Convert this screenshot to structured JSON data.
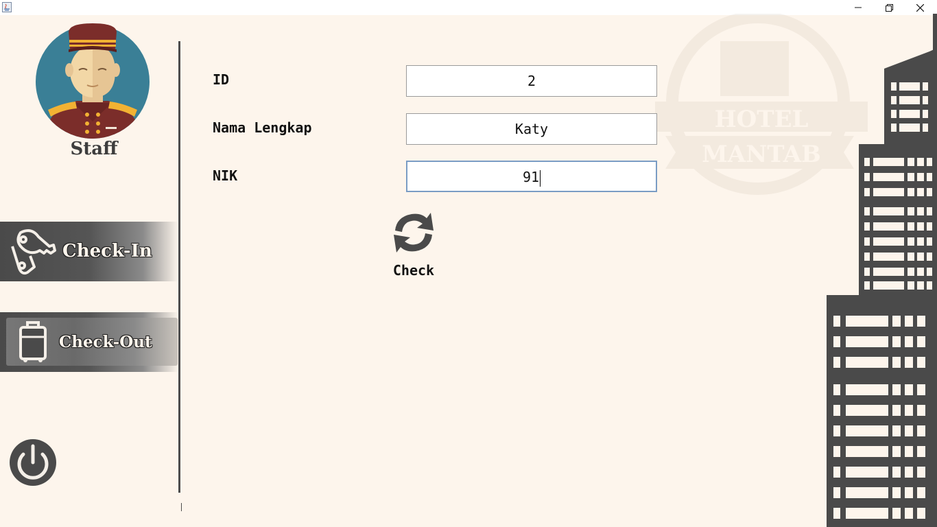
{
  "window": {
    "title": "",
    "controls": {
      "minimize": "minimize-icon",
      "restore": "restore-icon",
      "close": "close-icon"
    }
  },
  "sidebar": {
    "user_role": "Staff",
    "nav": [
      {
        "label": "Check-In",
        "icon": "keys-icon"
      },
      {
        "label": "Check-Out",
        "icon": "luggage-icon"
      }
    ],
    "logout_icon": "power-icon"
  },
  "form": {
    "id_label": "ID",
    "id_value": "2",
    "name_label": "Nama Lengkap",
    "name_value": "Katy",
    "nik_label": "NIK",
    "nik_value": "91",
    "check_label": "Check"
  },
  "watermark": {
    "line1": "HOTEL",
    "line2": "MANTAB"
  },
  "colors": {
    "background": "#fdf5ec",
    "dark": "#4a4a4a",
    "accent_focus": "#7a9cc4"
  }
}
